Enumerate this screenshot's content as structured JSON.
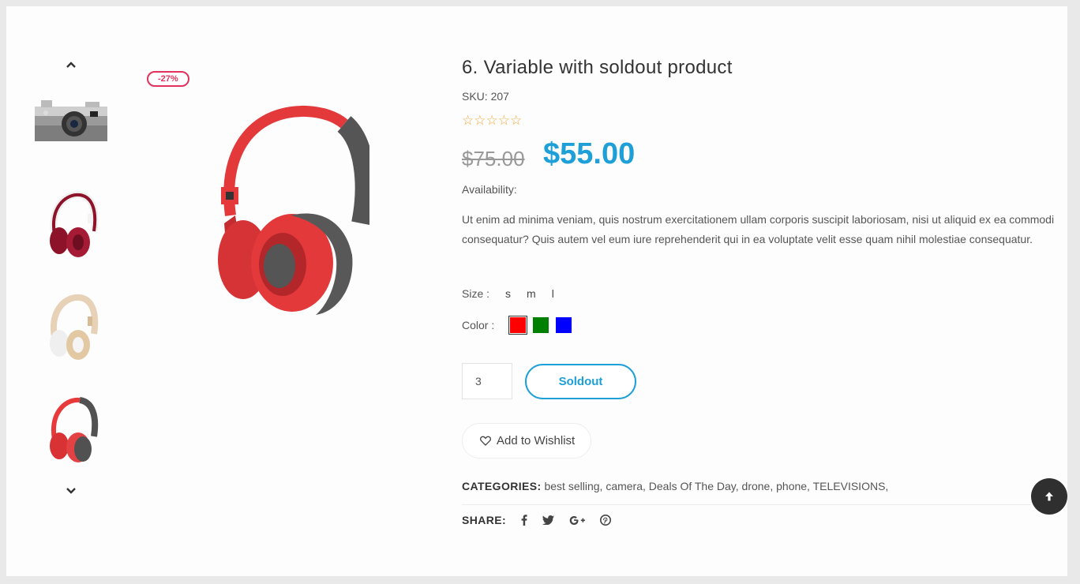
{
  "badge": "-27%",
  "product": {
    "title": "6. Variable with soldout product",
    "sku_label": "SKU:",
    "sku_value": "207",
    "stars": "☆☆☆☆☆",
    "rating": 0,
    "old_price": "$75.00",
    "new_price": "$55.00",
    "availability_label": "Availability:",
    "description": "Ut enim ad minima veniam, quis nostrum exercitationem ullam corporis suscipit laboriosam, nisi ut aliquid ex ea commodi consequatur? Quis autem vel eum iure reprehenderit qui in ea voluptate velit esse quam nihil molestiae consequatur."
  },
  "size": {
    "label": "Size :",
    "options": [
      "s",
      "m",
      "l"
    ]
  },
  "color": {
    "label": "Color :",
    "options": [
      "#ff0000",
      "#008000",
      "#0000ff"
    ],
    "selected": "#ff0000"
  },
  "quantity": "3",
  "soldout_label": "Soldout",
  "wishlist_label": "Add to Wishlist",
  "categories": {
    "label": "CATEGORIES:",
    "items": [
      "best selling,",
      "camera,",
      "Deals Of The Day,",
      "drone,",
      "phone,",
      "TELEVISIONS,"
    ]
  },
  "share": {
    "label": "SHARE:",
    "icons": [
      "facebook-icon",
      "twitter-icon",
      "google-plus-icon",
      "pinterest-icon"
    ]
  },
  "colors": {
    "accent": "#1e9fd8",
    "badge": "#e0325c",
    "star": "#f0a93b"
  }
}
